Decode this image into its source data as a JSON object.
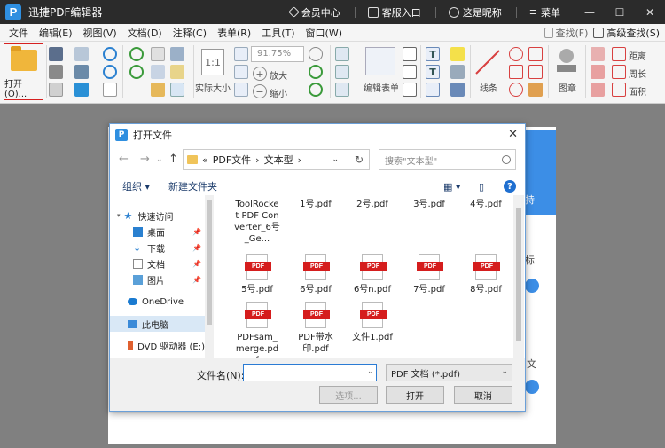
{
  "app": {
    "title": "迅捷PDF编辑器",
    "logo": "P",
    "member": "会员中心",
    "service": "客服入口",
    "user": "这是昵称",
    "menu": "菜单"
  },
  "menubar": {
    "items": [
      "文件",
      "编辑(E)",
      "视图(V)",
      "文档(D)",
      "注释(C)",
      "表单(R)",
      "工具(T)",
      "窗口(W)"
    ],
    "find": "查找(F)",
    "advanced_find": "高级查找(S)"
  },
  "toolbar": {
    "open_label": "打开(O)...",
    "zoom_value": "91.75%",
    "actual_size": "实际大小",
    "zoom_in": "放大",
    "zoom_out": "缩小",
    "edit_form": "编辑表单",
    "lines": "线条",
    "stamp": "图章",
    "distance": "距离",
    "perimeter": "周长",
    "area": "面积"
  },
  "background": {
    "side_text_1": "持",
    "side_text_2": "标",
    "side_text_3": "文"
  },
  "dialog": {
    "title": "打开文件",
    "logo": "P",
    "breadcrumb_prefix": "«",
    "breadcrumb": [
      "PDF文件",
      "文本型"
    ],
    "search_placeholder": "搜索\"文本型\"",
    "organize": "组织 ▾",
    "new_folder": "新建文件夹",
    "nav": {
      "quick_access": "快速访问",
      "desktop": "桌面",
      "downloads": "下载",
      "documents": "文档",
      "pictures": "图片",
      "onedrive": "OneDrive",
      "this_pc": "此电脑",
      "dvd": "DVD 驱动器 (E:)"
    },
    "files": [
      {
        "name": "ToolRocket PDF Converter_6号_Ge...",
        "type": "app"
      },
      {
        "name": "1号.pdf"
      },
      {
        "name": "2号.pdf"
      },
      {
        "name": "3号.pdf"
      },
      {
        "name": "4号.pdf"
      },
      {
        "name": "5号.pdf"
      },
      {
        "name": "6号.pdf"
      },
      {
        "name": "6号n.pdf"
      },
      {
        "name": "7号.pdf"
      },
      {
        "name": "8号.pdf"
      },
      {
        "name": "PDFsam_merge.pdf"
      },
      {
        "name": "PDF带水印.pdf"
      },
      {
        "name": "文件1.pdf"
      }
    ],
    "pdf_badge": "PDF",
    "filename_label": "文件名(N):",
    "filename_value": "",
    "filetype": "PDF 文档 (*.pdf)",
    "options_button": "选项...",
    "open_button": "打开",
    "cancel_button": "取消"
  },
  "colors": {
    "accent": "#2f8fe0",
    "pdf_red": "#d51d1d",
    "open_border": "#d62020"
  }
}
